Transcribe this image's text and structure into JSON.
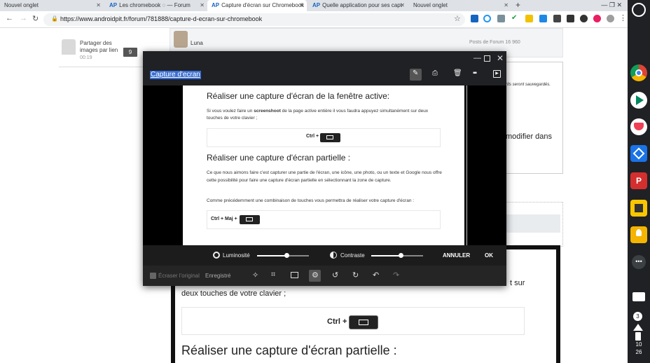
{
  "browser": {
    "tabs": [
      {
        "label": "Nouvel onglet",
        "favicon": ""
      },
      {
        "label": "Les chromebook ◌ — Forum",
        "favicon": "AP"
      },
      {
        "label": "Capture d'écran sur Chromebook",
        "favicon": "AP"
      },
      {
        "label": "Quelle application pour ses capt",
        "favicon": "AP"
      },
      {
        "label": "Nouvel onglet",
        "favicon": ""
      }
    ],
    "url": "https://www.androidpit.fr/forum/781888/capture-d-ecran-sur-chromebook",
    "tab_close": "✕",
    "new_tab": "+",
    "window_controls": "—   ❐   ✕"
  },
  "page": {
    "thread_item": {
      "title": "Partager des images par lien",
      "time": "00:19",
      "count": "9"
    },
    "post": {
      "author": "Luna",
      "forum_posts": "Posts de Forum 16 960"
    },
    "editor_hint": "rits seront sauvegardés.",
    "modifier_fragment": "modifier dans",
    "bg_line1_fragment": "t   sur",
    "bg_line2": "deux touches de votre clavier ;",
    "bg_ctrl": "Ctrl +",
    "bg_heading": "Réaliser une capture d'écran partielle :"
  },
  "editor": {
    "title": "Capture d'ecran",
    "doc": {
      "heading1": "Réaliser une capture d'écran de la fenêtre active:",
      "p1_before": "Si vous voulez faire un ",
      "p1_bold": "screenshoot",
      "p1_after": " de la page active entière il vous faudra appuyez simultanément  sur deux touches de votre clavier ;",
      "ctrl1": "Ctrl +",
      "heading2": "Réaliser une capture d'écran partielle :",
      "p2": "Ce que nous aimons faire c'est capturer une partie de l'écran, une icône, une photo, ou un texte et Google nous offre cette possibilité pour faire une capture d'écran partielle en sélectionnant la zone de capture.",
      "p3": "Comme précédemment une combinaison de touches vous permettra de réaliser votre capture d'écran :",
      "ctrl2": "Ctrl + Maj +"
    },
    "adjust": {
      "brightness_label": "Luminosité",
      "brightness_value": 0.58,
      "contrast_label": "Contraste",
      "contrast_value": 0.57,
      "cancel": "ANNULER",
      "ok": "OK"
    },
    "bottom": {
      "erase_original": "Écraser l'original",
      "saved": "Enregistré"
    }
  },
  "shelf": {
    "notification_count": "3",
    "time_hour": "10",
    "time_min": "26"
  },
  "colors": {
    "accent": "#3a6fd4",
    "shelf_bg": "#202124",
    "editor_bg": "#202124"
  }
}
